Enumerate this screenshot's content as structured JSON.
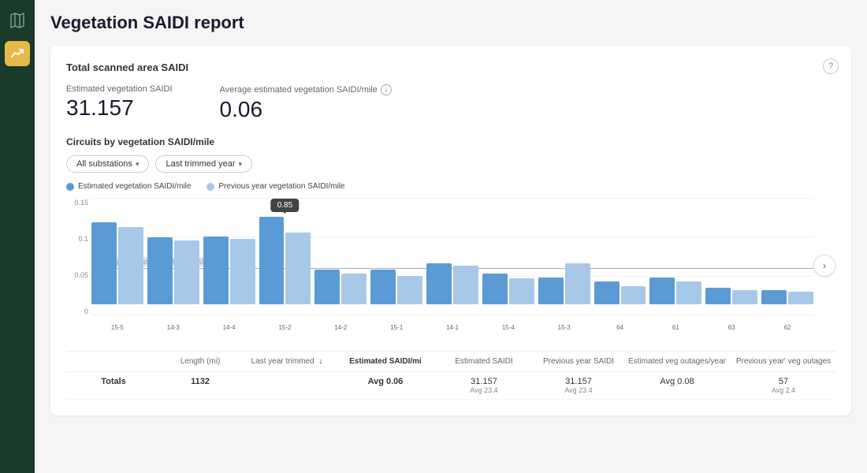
{
  "page": {
    "title": "Vegetation SAIDI report"
  },
  "sidebar": {
    "map_icon": "🗺",
    "trend_icon": "↗"
  },
  "summary_card": {
    "title": "Total scanned area SAIDI",
    "estimated_label": "Estimated vegetation SAIDI",
    "estimated_value": "31.157",
    "avg_label": "Average estimated vegetation SAIDI/mile",
    "avg_value": "0.06",
    "help_label": "?"
  },
  "circuits_section": {
    "title": "Circuits by vegetation SAIDI/mile",
    "filter_substations": "All substations",
    "filter_year": "Last trimmed year",
    "legend_estimated": "Estimated vegetation SAIDI/mile",
    "legend_previous": "Previous year vegetation SAIDI/mile"
  },
  "chart": {
    "y_max": "0.15",
    "y_mid": "0.1",
    "y_low": "0.05",
    "y_zero": "0",
    "avg_line_pct": 60,
    "avg_line_label": "Average estimated vegetation SAIDI/mile",
    "tooltip_value": "0.85",
    "bars": [
      {
        "label": "15-5",
        "dark": 80,
        "light": 75
      },
      {
        "label": "14-3",
        "dark": 65,
        "light": 62
      },
      {
        "label": "14-4",
        "dark": 66,
        "light": 64
      },
      {
        "label": "15-2",
        "dark": 85,
        "light": 70
      },
      {
        "label": "14-2",
        "dark": 34,
        "light": 30
      },
      {
        "label": "15-1",
        "dark": 34,
        "light": 28
      },
      {
        "label": "14-1",
        "dark": 40,
        "light": 38
      },
      {
        "label": "15-4",
        "dark": 30,
        "light": 25
      },
      {
        "label": "15-3",
        "dark": 26,
        "light": 40
      },
      {
        "label": "64",
        "dark": 22,
        "light": 18
      },
      {
        "label": "61",
        "dark": 26,
        "light": 22
      },
      {
        "label": "63",
        "dark": 16,
        "light": 14
      },
      {
        "label": "62",
        "dark": 14,
        "light": 12
      }
    ]
  },
  "table": {
    "headers": [
      {
        "text": "",
        "sub": ""
      },
      {
        "text": "Length (mi)",
        "sub": ""
      },
      {
        "text": "Last year trimmed",
        "sub": "",
        "sort": true
      },
      {
        "text": "Estimated SAIDI/mi",
        "sub": "",
        "bold": true
      },
      {
        "text": "Estimated SAIDI",
        "sub": ""
      },
      {
        "text": "Previous year SAIDI",
        "sub": ""
      },
      {
        "text": "Estimated veg outages/year",
        "sub": ""
      },
      {
        "text": "Previous year' veg outages",
        "sub": ""
      }
    ],
    "totals_row": {
      "label": "Totals",
      "length": "1132",
      "last_year": "",
      "estimated_saidi_mi": "Avg 0.06",
      "estimated_saidi": "31.157",
      "estimated_saidi_sub": "Avg 23.4",
      "prev_year_saidi": "31.157",
      "prev_year_saidi_sub": "Avg 23.4",
      "est_veg_outages": "Avg 0.08",
      "prev_year_veg": "57",
      "prev_year_veg_sub": "Avg 2.4"
    }
  }
}
